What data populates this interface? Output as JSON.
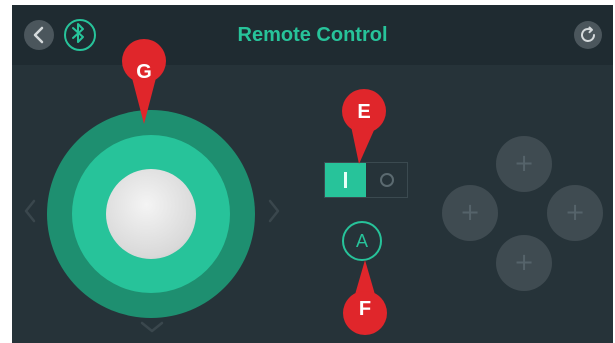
{
  "header": {
    "title": "Remote Control",
    "back_icon": "chevron-left-icon",
    "bluetooth_icon": "bluetooth-icon",
    "refresh_icon": "refresh-icon"
  },
  "joystick": {
    "knob_icon": "joystick-knob",
    "arrows": [
      "chevron-left-icon",
      "chevron-right-icon",
      "chevron-down-icon"
    ]
  },
  "toggle": {
    "on_symbol": "|",
    "off_symbol": "○",
    "state": "on"
  },
  "action_button": {
    "label": "A"
  },
  "dpad": {
    "up": "+",
    "left": "+",
    "right": "+",
    "down": "+"
  },
  "markers": {
    "g": "G",
    "e": "E",
    "f": "F"
  },
  "colors": {
    "accent": "#27c39a",
    "ring": "#1e8f70",
    "background": "#263339",
    "marker": "#e0262b"
  }
}
